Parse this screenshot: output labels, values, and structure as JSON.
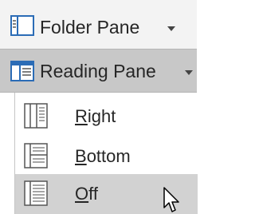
{
  "ribbon": {
    "folder_pane": {
      "label": "Folder Pane",
      "icon": "folder-pane-icon"
    },
    "reading_pane": {
      "label": "Reading Pane",
      "icon": "reading-pane-icon"
    }
  },
  "menu": {
    "items": [
      {
        "label": "Right",
        "icon": "reading-pane-right-icon",
        "accelerator": "R"
      },
      {
        "label": "Bottom",
        "icon": "reading-pane-bottom-icon",
        "accelerator": "B"
      },
      {
        "label": "Off",
        "icon": "reading-pane-off-icon",
        "accelerator": "O",
        "hovered": true
      }
    ]
  },
  "colors": {
    "icon_blue": "#2b6cb6",
    "hover_gray": "#d2d2d2",
    "pressed_gray": "#c8c8c8",
    "text": "#262626"
  }
}
